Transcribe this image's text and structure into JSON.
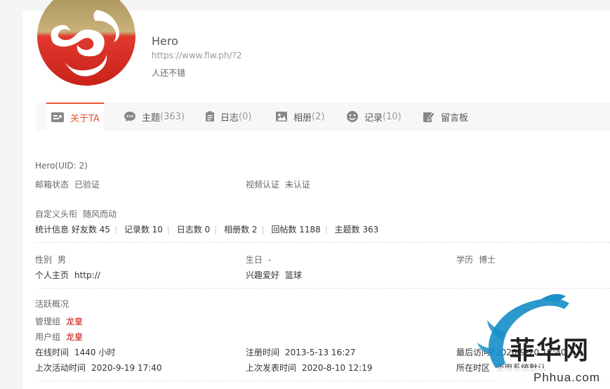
{
  "profile": {
    "name": "Hero",
    "url": "https://www.flw.ph/?2",
    "bio": "人还不错"
  },
  "tabs": [
    {
      "label": "关于TA",
      "count": "",
      "icon": "card-icon"
    },
    {
      "label": "主题",
      "count": "(363)",
      "icon": "chat-bubble-icon"
    },
    {
      "label": "日志",
      "count": "(0)",
      "icon": "notepad-icon"
    },
    {
      "label": "相册",
      "count": "(2)",
      "icon": "image-icon"
    },
    {
      "label": "记录",
      "count": "(10)",
      "icon": "smiley-icon"
    },
    {
      "label": "留言板",
      "count": "",
      "icon": "pencil-note-icon"
    }
  ],
  "info": {
    "uid": "Hero(UID: 2)",
    "email_label": "邮箱状态",
    "email_value": "已验证",
    "video_label": "视频认证",
    "video_value": "未认证",
    "title_label": "自定义头衔",
    "title_value": "随风而动",
    "stats_label": "统计信息",
    "stats": [
      "好友数 45",
      "记录数 10",
      "日志数 0",
      "相册数 2",
      "回帖数 1188",
      "主题数 363"
    ],
    "gender_label": "性别",
    "gender_value": "男",
    "birthday_label": "生日",
    "birthday_value": "-",
    "education_label": "学历",
    "education_value": "博士",
    "homepage_label": "个人主页",
    "homepage_value": "http://",
    "hobby_label": "兴趣爱好",
    "hobby_value": "篮球",
    "activity_title": "活跃概况",
    "admin_group_label": "管理组",
    "admin_group_value": "龙皇",
    "user_group_label": "用户组",
    "user_group_value": "龙皇",
    "online_label": "在线时间",
    "online_value": "1440 小时",
    "register_label": "注册时间",
    "register_value": "2013-5-13 16:27",
    "last_visit_label": "最后访问",
    "last_visit_value": "2020-9-20 17:40",
    "last_active_label": "上次活动时间",
    "last_active_value": "2020-9-19 17:40",
    "last_post_label": "上次发表时间",
    "last_post_value": "2020-8-10 12:19",
    "timezone_label": "所在时区",
    "timezone_value": "使用系统默认"
  },
  "watermark": {
    "text": "菲华网",
    "domain": "Phhua.com"
  },
  "colors": {
    "accent": "#e8542e",
    "red_value": "#cc0000",
    "watermark_blue": "#1a8fc8",
    "watermark_dark": "#222222"
  }
}
